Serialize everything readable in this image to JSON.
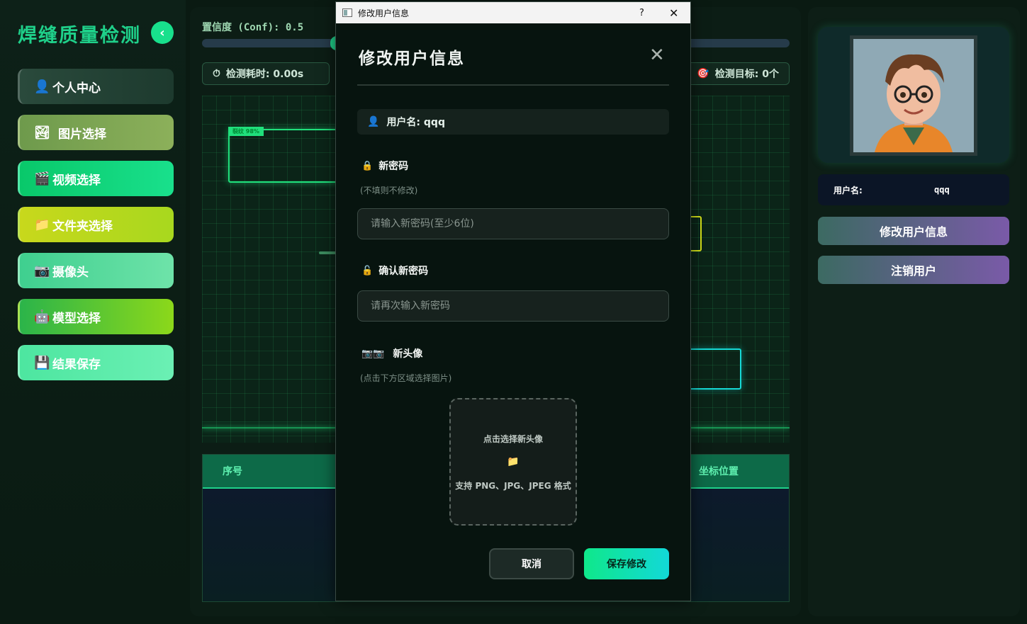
{
  "app": {
    "title": "焊缝质量检测"
  },
  "sidebar": {
    "items": [
      {
        "label": "个人中心",
        "icon": "👤"
      },
      {
        "label": "图片选择",
        "icon": "🏞"
      },
      {
        "label": "视频选择",
        "icon": "🎬"
      },
      {
        "label": "文件夹选择",
        "icon": "📁"
      },
      {
        "label": "摄像头",
        "icon": "📷"
      },
      {
        "label": "模型选择",
        "icon": "🤖"
      },
      {
        "label": "结果保存",
        "icon": "💾"
      }
    ]
  },
  "center": {
    "conf_label": "置信度 (Conf): 0.5",
    "conf_value": 0.5,
    "time_label": "检测耗时: 0.00s",
    "target_label": "检测目标: 0个",
    "detection_tag": "裂纹 98%",
    "table": {
      "col_seq": "序号",
      "col_pos": "坐标位置"
    }
  },
  "right": {
    "username_label": "用户名:",
    "username_value": "qqq",
    "edit_btn": "修改用户信息",
    "logout_btn": "注销用户"
  },
  "dialog": {
    "window_title": "修改用户信息",
    "help": "?",
    "close": "✕",
    "title": "修改用户信息",
    "username_text": "用户名: qqq",
    "new_pwd_label": "新密码",
    "new_pwd_hint": "(不填则不修改)",
    "new_pwd_placeholder": "请输入新密码(至少6位)",
    "confirm_label": "确认新密码",
    "confirm_placeholder": "请再次输入新密码",
    "avatar_label": "新头像",
    "avatar_hint": "(点击下方区域选择图片)",
    "upload_title": "点击选择新头像",
    "upload_sub": "支持 PNG、JPG、JPEG 格式",
    "cancel": "取消",
    "save": "保存修改"
  },
  "colors": {
    "accent": "#1fd08a",
    "background": "#0a1a12"
  }
}
